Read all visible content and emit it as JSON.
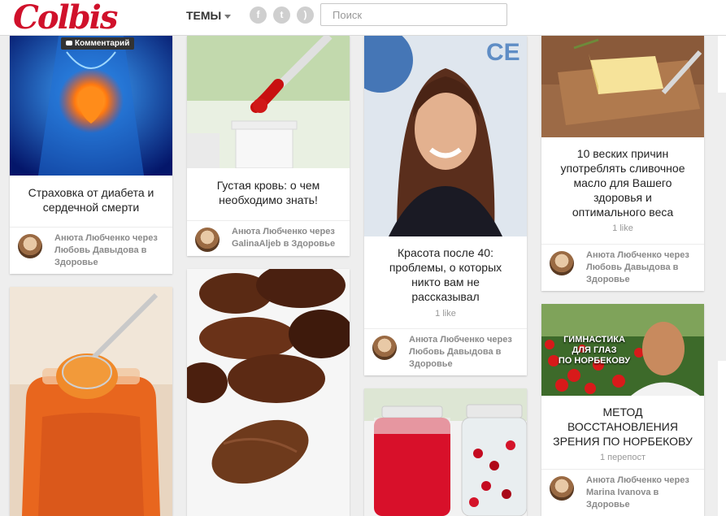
{
  "header": {
    "logo": "Colbis",
    "topics_label": "ТЕМЫ",
    "search_placeholder": "Поиск",
    "social": [
      "facebook-icon",
      "twitter-icon",
      "rss-icon"
    ]
  },
  "cards": [
    {
      "comment_label": "Комментарий",
      "title_lines": [
        "Страховка от диабета и",
        "сердечной смерти"
      ],
      "author_lines": [
        "Анюта Любченко через",
        "Любовь Давыдова в",
        "Здоровье"
      ]
    },
    {
      "title_lines": [
        "Густая кровь: о чем",
        "необходимо знать!"
      ],
      "author_lines": [
        "Анюта Любченко через",
        "GalinaAljeb в Здоровье"
      ]
    },
    {
      "title_lines": [
        "Красота после 40:",
        "проблемы, о которых",
        "никто вам не",
        "рассказывал"
      ],
      "stat": "1 like",
      "author_lines": [
        "Анюта Любченко через",
        "Любовь Давыдова в",
        "Здоровье"
      ]
    },
    {
      "title_lines": [
        "10 веских причин",
        "употреблять сливочное",
        "масло для Вашего",
        "здоровья и",
        "оптимального веса"
      ],
      "stat": "1 like",
      "author_lines": [
        "Анюта Любченко через",
        "Любовь Давыдова в",
        "Здоровье"
      ]
    },
    {
      "overlay_lines": [
        "ГИМНАСТИКА",
        "ДЛЯ ГЛАЗ",
        "ПО НОРБЕКОВУ"
      ],
      "title_lines": [
        "МЕТОД",
        "ВОССТАНОВЛЕНИЯ",
        "ЗРЕНИЯ ПО НОРБЕКОВУ"
      ],
      "stat": "1 перепост",
      "author_lines": [
        "Анюта Любченко через",
        "Marina Ivanova в",
        "Здоровье"
      ]
    }
  ]
}
